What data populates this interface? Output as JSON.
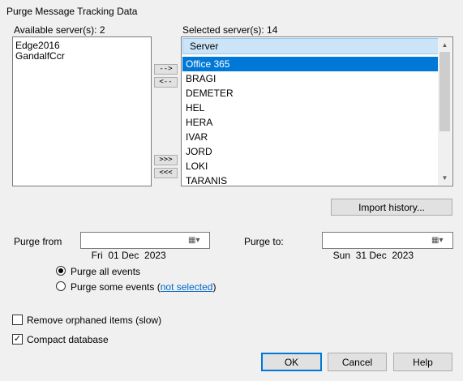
{
  "window": {
    "title": "Purge Message Tracking Data"
  },
  "available": {
    "label": "Available server(s): 2",
    "items": [
      "Edge2016",
      "GandalfCcr"
    ]
  },
  "move_buttons": {
    "add": "-->",
    "remove": "<--",
    "add_all": ">>>",
    "remove_all": "<<<"
  },
  "selected": {
    "label": "Selected server(s): 14",
    "column_header": "Server",
    "items": [
      "Office 365",
      "BRAGI",
      "DEMETER",
      "HEL",
      "HERA",
      "IVAR",
      "JORD",
      "LOKI",
      "TARANIS"
    ],
    "selected_item": "Office 365"
  },
  "import_history": {
    "label": "Import history..."
  },
  "purge_from": {
    "label": "Purge from",
    "value": "Fri  01 Dec  2023"
  },
  "purge_to": {
    "label": "Purge to:",
    "value": "Sun  31 Dec  2023"
  },
  "purge_events": {
    "all_label": "Purge all events",
    "some_label": "Purge some events (",
    "some_link": "not selected",
    "some_suffix": ")",
    "selected_option": "all"
  },
  "options": {
    "orphaned_label": "Remove orphaned items (slow)",
    "orphaned_checked": false,
    "compact_label": "Compact database",
    "compact_checked": true
  },
  "footer": {
    "ok": "OK",
    "cancel": "Cancel",
    "help": "Help"
  },
  "colors": {
    "selection": "#0078d7",
    "header": "#cce4f7",
    "link": "#0066cc"
  }
}
